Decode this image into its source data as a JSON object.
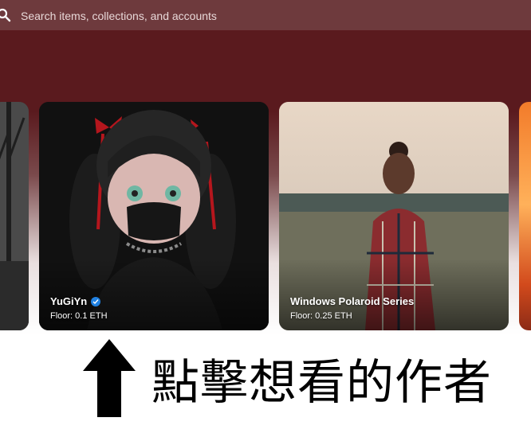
{
  "search": {
    "placeholder": "Search items, collections, and accounts"
  },
  "collections": [
    {
      "title": "YuGiYn",
      "verified": true,
      "floor": "Floor: 0.1 ETH"
    },
    {
      "title": "Windows Polaroid Series",
      "verified": false,
      "floor": "Floor: 0.25 ETH"
    }
  ],
  "annotation": {
    "text": "點擊想看的作者"
  },
  "colors": {
    "topbar": "#6e3a3d",
    "hero": "#5a1a1e",
    "verified": "#2081e2"
  },
  "icons": [
    "search-icon",
    "verified-icon",
    "up-arrow-icon"
  ]
}
